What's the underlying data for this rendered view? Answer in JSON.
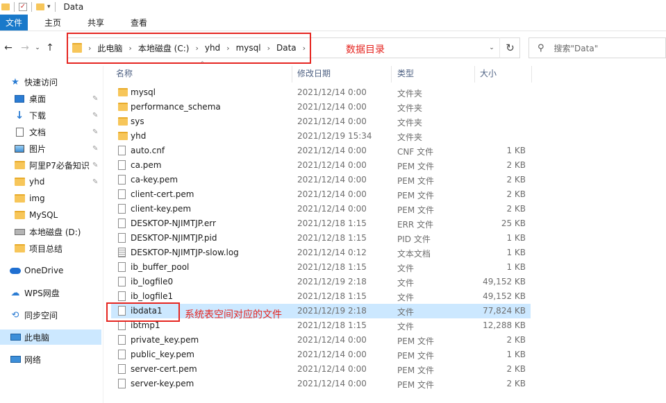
{
  "window": {
    "title": "Data"
  },
  "ribbon": {
    "tabs": [
      "文件",
      "主页",
      "共享",
      "查看"
    ]
  },
  "breadcrumb": [
    "此电脑",
    "本地磁盘 (C:)",
    "yhd",
    "mysql",
    "Data"
  ],
  "search": {
    "placeholder": "搜索\"Data\""
  },
  "annotations": {
    "address": "数据目录",
    "file": "系统表空间对应的文件"
  },
  "nav": {
    "quick_access": "快速访问",
    "items": [
      {
        "label": "桌面",
        "icon": "desktop-icon",
        "pinned": true
      },
      {
        "label": "下载",
        "icon": "download-icon",
        "pinned": true
      },
      {
        "label": "文档",
        "icon": "document-icon",
        "pinned": true
      },
      {
        "label": "图片",
        "icon": "picture-icon",
        "pinned": true
      },
      {
        "label": "阿里P7必备知识",
        "icon": "folder-icon",
        "pinned": true
      },
      {
        "label": "yhd",
        "icon": "folder-icon",
        "pinned": true
      },
      {
        "label": "img",
        "icon": "folder-icon",
        "pinned": false
      },
      {
        "label": "MySQL",
        "icon": "folder-icon",
        "pinned": false
      },
      {
        "label": "本地磁盘 (D:)",
        "icon": "drive-icon",
        "pinned": false
      },
      {
        "label": "项目总结",
        "icon": "folder-icon",
        "pinned": false
      }
    ],
    "onedrive": "OneDrive",
    "wps": "WPS网盘",
    "sync": "同步空间",
    "this_pc": "此电脑",
    "network": "网络"
  },
  "columns": {
    "name": "名称",
    "date": "修改日期",
    "type": "类型",
    "size": "大小"
  },
  "files": [
    {
      "name": "mysql",
      "date": "2021/12/14 0:00",
      "type": "文件夹",
      "size": "",
      "kind": "folder"
    },
    {
      "name": "performance_schema",
      "date": "2021/12/14 0:00",
      "type": "文件夹",
      "size": "",
      "kind": "folder"
    },
    {
      "name": "sys",
      "date": "2021/12/14 0:00",
      "type": "文件夹",
      "size": "",
      "kind": "folder"
    },
    {
      "name": "yhd",
      "date": "2021/12/19 15:34",
      "type": "文件夹",
      "size": "",
      "kind": "folder"
    },
    {
      "name": "auto.cnf",
      "date": "2021/12/14 0:00",
      "type": "CNF 文件",
      "size": "1 KB",
      "kind": "file"
    },
    {
      "name": "ca.pem",
      "date": "2021/12/14 0:00",
      "type": "PEM 文件",
      "size": "2 KB",
      "kind": "file"
    },
    {
      "name": "ca-key.pem",
      "date": "2021/12/14 0:00",
      "type": "PEM 文件",
      "size": "2 KB",
      "kind": "file"
    },
    {
      "name": "client-cert.pem",
      "date": "2021/12/14 0:00",
      "type": "PEM 文件",
      "size": "2 KB",
      "kind": "file"
    },
    {
      "name": "client-key.pem",
      "date": "2021/12/14 0:00",
      "type": "PEM 文件",
      "size": "2 KB",
      "kind": "file"
    },
    {
      "name": "DESKTOP-NJIMTJP.err",
      "date": "2021/12/18 1:15",
      "type": "ERR 文件",
      "size": "25 KB",
      "kind": "file"
    },
    {
      "name": "DESKTOP-NJIMTJP.pid",
      "date": "2021/12/18 1:15",
      "type": "PID 文件",
      "size": "1 KB",
      "kind": "file"
    },
    {
      "name": "DESKTOP-NJIMTJP-slow.log",
      "date": "2021/12/14 0:12",
      "type": "文本文档",
      "size": "1 KB",
      "kind": "text"
    },
    {
      "name": "ib_buffer_pool",
      "date": "2021/12/18 1:15",
      "type": "文件",
      "size": "1 KB",
      "kind": "file"
    },
    {
      "name": "ib_logfile0",
      "date": "2021/12/19 2:18",
      "type": "文件",
      "size": "49,152 KB",
      "kind": "file"
    },
    {
      "name": "ib_logfile1",
      "date": "2021/12/18 1:15",
      "type": "文件",
      "size": "49,152 KB",
      "kind": "file"
    },
    {
      "name": "ibdata1",
      "date": "2021/12/19 2:18",
      "type": "文件",
      "size": "77,824 KB",
      "kind": "file"
    },
    {
      "name": "ibtmp1",
      "date": "2021/12/18 1:15",
      "type": "文件",
      "size": "12,288 KB",
      "kind": "file"
    },
    {
      "name": "private_key.pem",
      "date": "2021/12/14 0:00",
      "type": "PEM 文件",
      "size": "2 KB",
      "kind": "file"
    },
    {
      "name": "public_key.pem",
      "date": "2021/12/14 0:00",
      "type": "PEM 文件",
      "size": "1 KB",
      "kind": "file"
    },
    {
      "name": "server-cert.pem",
      "date": "2021/12/14 0:00",
      "type": "PEM 文件",
      "size": "2 KB",
      "kind": "file"
    },
    {
      "name": "server-key.pem",
      "date": "2021/12/14 0:00",
      "type": "PEM 文件",
      "size": "2 KB",
      "kind": "file"
    }
  ],
  "colors": {
    "accent": "#1979ca",
    "selection": "#cce8ff",
    "annotation": "#e52520",
    "folder": "#f7c65a"
  }
}
